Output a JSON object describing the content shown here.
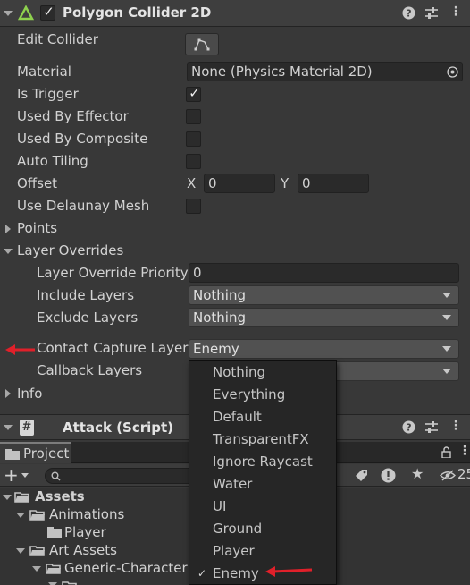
{
  "polygon_collider": {
    "title": "Polygon Collider 2D",
    "enabled": true,
    "edit_collider_label": "Edit Collider",
    "material_label": "Material",
    "material_value": "None (Physics Material 2D)",
    "is_trigger_label": "Is Trigger",
    "is_trigger": true,
    "used_by_effector_label": "Used By Effector",
    "used_by_composite_label": "Used By Composite",
    "auto_tiling_label": "Auto Tiling",
    "offset_label": "Offset",
    "offset_x_label": "X",
    "offset_x": "0",
    "offset_y_label": "Y",
    "offset_y": "0",
    "use_delaunay_label": "Use Delaunay Mesh",
    "points_label": "Points",
    "layer_overrides_label": "Layer Overrides",
    "layer_override_priority_label": "Layer Override Priority",
    "layer_override_priority": "0",
    "include_layers_label": "Include Layers",
    "include_layers_value": "Nothing",
    "exclude_layers_label": "Exclude Layers",
    "exclude_layers_value": "Nothing",
    "contact_capture_label": "Contact Capture Layers",
    "contact_capture_value": "Enemy",
    "callback_layers_label": "Callback Layers",
    "info_label": "Info"
  },
  "attack_script": {
    "title": "Attack (Script)",
    "icon": "hash-icon"
  },
  "layer_menu": {
    "items": [
      "Nothing",
      "Everything",
      "Default",
      "TransparentFX",
      "Ignore Raycast",
      "Water",
      "UI",
      "Ground",
      "Player",
      "Enemy"
    ],
    "checked": "Enemy",
    "check_glyph": "✓"
  },
  "project": {
    "tab_label": "Project",
    "add_label": "+",
    "count_label": "25",
    "tree": [
      {
        "label": "Assets",
        "bold": true
      },
      {
        "label": "Animations"
      },
      {
        "label": "Player"
      },
      {
        "label": "Art Assets"
      },
      {
        "label": "Generic-Character"
      }
    ]
  },
  "colors": {
    "annotation_arrow": "#e0202a",
    "unity_green": "#78c84a"
  }
}
